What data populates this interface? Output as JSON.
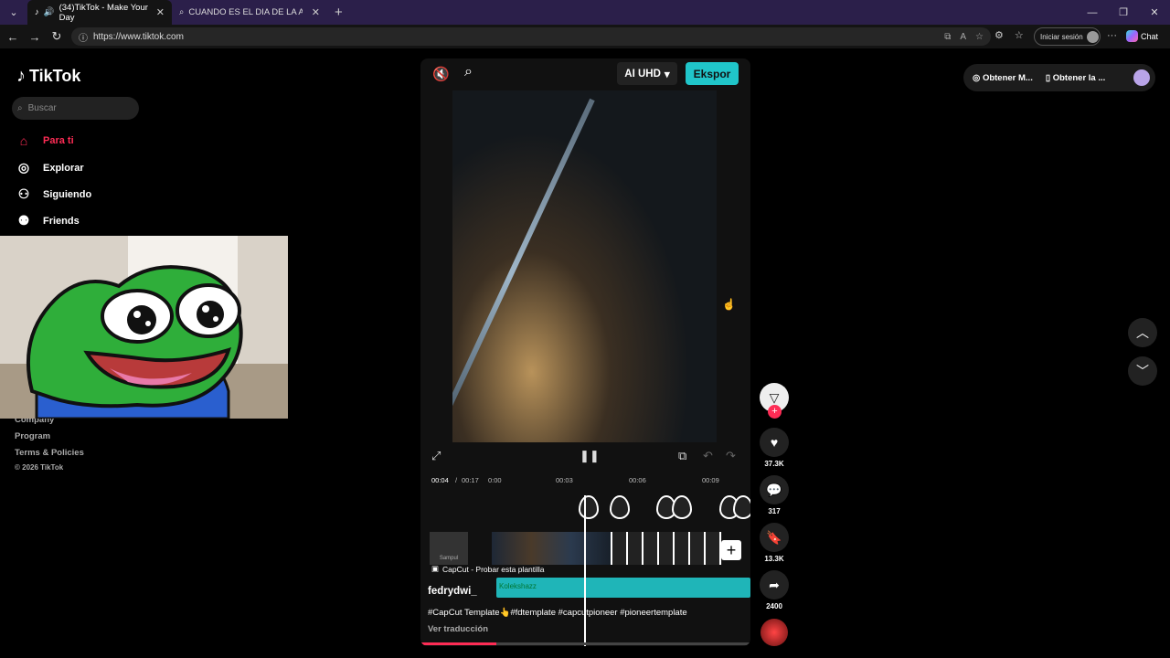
{
  "browser": {
    "tabs": [
      {
        "title": "(34)TikTok - Make Your Day",
        "active": true
      },
      {
        "title": "CUANDO ES EL DIA DE LA AMISTAD",
        "active": false
      }
    ],
    "url": "https://www.tiktok.com",
    "signin_label": "Iniciar sesión",
    "chat_label": "Chat"
  },
  "sidebar": {
    "brand": "TikTok",
    "search_placeholder": "Buscar",
    "items": [
      {
        "label": "Para ti",
        "icon": "home-icon",
        "active": true
      },
      {
        "label": "Explorar",
        "icon": "compass-icon",
        "active": false
      },
      {
        "label": "Siguiendo",
        "icon": "following-icon",
        "active": false
      },
      {
        "label": "Friends",
        "icon": "friends-icon",
        "active": false
      }
    ],
    "footer": {
      "company": "Company",
      "program": "Program",
      "terms": "Terms & Policies",
      "copyright": "© 2026 TikTok"
    }
  },
  "header": {
    "get_coins": "Obtener M...",
    "get_app": "Obtener la ..."
  },
  "player": {
    "ai_quality": "AI UHD",
    "export_label": "Ekspor",
    "time_current": "00:04",
    "time_total": "00:17",
    "ticks": [
      "0:00",
      "00:03",
      "00:06",
      "00:09"
    ],
    "capcut_label": "CapCut - Probar esta plantilla",
    "audio_label": "Kolekshazz",
    "sampul": "Sampul",
    "username": "fedrydwi_",
    "caption": "#CapCut Template👆#fdtemplate #capcutpioneer #pioneertemplate",
    "translate": "Ver traducción",
    "progress": 0.23
  },
  "actions": {
    "likes": "37.3K",
    "comments": "317",
    "saves": "13.3K",
    "shares": "2400"
  },
  "colors": {
    "accent": "#fe2c55",
    "capcut_teal": "#20c5c9",
    "tabbar": "#2b1f4a"
  }
}
